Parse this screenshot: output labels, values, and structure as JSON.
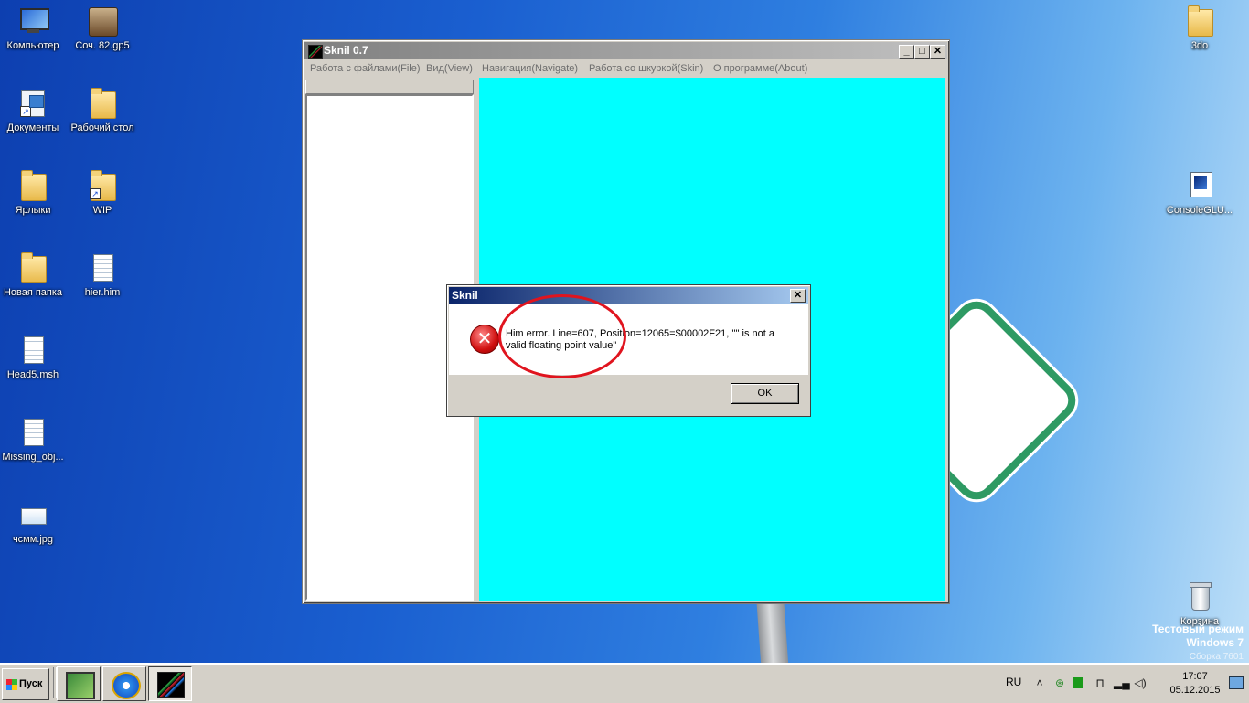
{
  "desktop": {
    "icons_left": [
      {
        "label": "Компьютер",
        "icon": "computer-icon"
      },
      {
        "label": "Соч. 82.gp5",
        "icon": "gp5-file-icon"
      },
      {
        "label": "Документы",
        "icon": "documents-icon"
      },
      {
        "label": "Рабочий стол",
        "icon": "folder-icon"
      },
      {
        "label": "Ярлыки",
        "icon": "folder-icon"
      },
      {
        "label": "WIP",
        "icon": "folder-shortcut-icon"
      },
      {
        "label": "Новая папка",
        "icon": "folder-icon"
      },
      {
        "label": "hier.him",
        "icon": "file-icon"
      },
      {
        "label": "Head5.msh",
        "icon": "file-icon"
      },
      {
        "label": "Missing_obj...",
        "icon": "text-file-icon"
      },
      {
        "label": "чсмм.jpg",
        "icon": "image-file-icon"
      }
    ],
    "icons_right": [
      {
        "label": "3do",
        "icon": "folder-icon"
      },
      {
        "label": "ConsoleGLU...",
        "icon": "app-icon"
      },
      {
        "label": "Корзина",
        "icon": "recycle-bin-icon"
      }
    ],
    "watermark": {
      "line1": "Тестовый режим",
      "line2": "Windows 7",
      "line3": "Сборка 7601"
    }
  },
  "window": {
    "title": "Sknil 0.7",
    "buttons": {
      "minimize": "_",
      "maximize": "□",
      "close": "✕"
    },
    "menu": [
      "Работа с файлами(File)",
      "Вид(View)",
      "Навигация(Navigate)",
      "Работа со шкуркой(Skin)",
      "О программе(About)"
    ],
    "canvas_color": "#00ffff"
  },
  "dialog": {
    "title": "Sknil",
    "close": "✕",
    "message": "Him error. Line=607, Position=12065=$00002F21, '\"' is not a valid floating point value\"",
    "icon": "error-icon",
    "ok_label": "OK",
    "annotation_color": "#e0141e"
  },
  "taskbar": {
    "start_label": "Пуск",
    "tasks": [
      {
        "icon": "monitor-app-icon",
        "active": false
      },
      {
        "icon": "internet-explorer-icon",
        "active": false
      },
      {
        "icon": "sknil-app-icon",
        "active": true
      }
    ],
    "tray": {
      "language": "RU",
      "time": "17:07",
      "date": "05.12.2015"
    }
  }
}
